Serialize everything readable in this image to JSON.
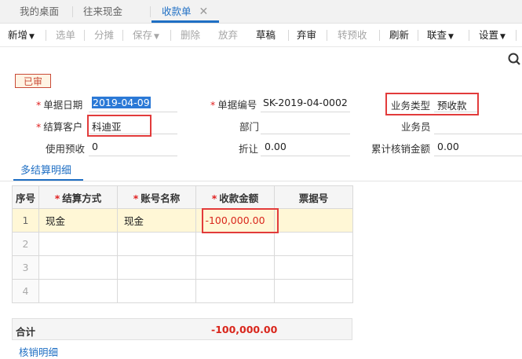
{
  "tabs": [
    {
      "label": "我的桌面"
    },
    {
      "label": "往来现金"
    },
    {
      "label": "收款单",
      "active": true
    }
  ],
  "toolbar": {
    "new": "新增",
    "select": "选单",
    "split": "分摊",
    "save": "保存",
    "delete": "删除",
    "discard": "放弃",
    "draft": "草稿",
    "unapprove": "弃审",
    "convert_prepaid": "转预收",
    "refresh": "刷新",
    "linked_query": "联查",
    "settings": "设置"
  },
  "icons": {
    "tab_close": "close-icon",
    "caret": "chevron-down-icon",
    "search": "search-icon"
  },
  "status": "已审",
  "form": {
    "date_label": "单据日期",
    "date_value": "2019-04-09",
    "doc_no_label": "单据编号",
    "doc_no_value": "SK-2019-04-0002",
    "biz_type_label": "业务类型",
    "biz_type_value": "预收款",
    "customer_label": "结算客户",
    "customer_value": "科迪亚",
    "dept_label": "部门",
    "dept_value": "",
    "salesman_label": "业务员",
    "salesman_value": "",
    "use_prepaid_label": "使用预收",
    "use_prepaid_value": "0",
    "discount_label": "折让",
    "discount_value": "0.00",
    "cum_writeoff_label": "累计核销金额",
    "cum_writeoff_value": "0.00"
  },
  "detail_tab": "多结算明细",
  "grid": {
    "headers": {
      "seq": "序号",
      "method": "结算方式",
      "account": "账号名称",
      "amount": "收款金额",
      "bill_no": "票据号"
    },
    "rows": [
      {
        "seq": "1",
        "method": "现金",
        "account": "现金",
        "amount": "-100,000.00",
        "bill_no": ""
      },
      {
        "seq": "2",
        "method": "",
        "account": "",
        "amount": "",
        "bill_no": ""
      },
      {
        "seq": "3",
        "method": "",
        "account": "",
        "amount": "",
        "bill_no": ""
      },
      {
        "seq": "4",
        "method": "",
        "account": "",
        "amount": "",
        "bill_no": ""
      }
    ]
  },
  "total": {
    "label": "合计",
    "amount": "-100,000.00"
  },
  "bottom_tab": "核销明细",
  "colors": {
    "accent": "#1f6fc4",
    "highlight_box": "#e23b3b",
    "negative_amount": "#d9261c",
    "row_highlight": "#fff7d6"
  }
}
